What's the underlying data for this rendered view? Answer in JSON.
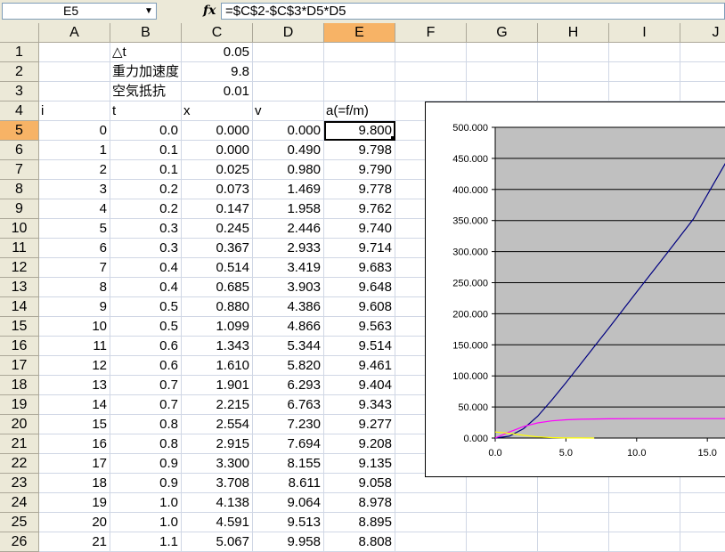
{
  "formula_bar": {
    "name_box": "E5",
    "fx_label": "fx",
    "formula": "=$C$2-$C$3*D5*D5"
  },
  "columns": [
    "A",
    "B",
    "C",
    "D",
    "E",
    "F",
    "G",
    "H",
    "I",
    "J"
  ],
  "selected_column": "E",
  "selected_row": 5,
  "rows": [
    {
      "n": "1",
      "a": "",
      "b": "△t",
      "c": "0.05",
      "d": "",
      "e": ""
    },
    {
      "n": "2",
      "a": "",
      "b": "重力加速度",
      "c": "9.8",
      "d": "",
      "e": ""
    },
    {
      "n": "3",
      "a": "",
      "b": "空気抵抗",
      "c": "0.01",
      "d": "",
      "e": ""
    },
    {
      "n": "4",
      "a": "i",
      "b": "t",
      "c": "x",
      "d": "v",
      "e": "a(=f/m)"
    },
    {
      "n": "5",
      "a": "0",
      "b": "0.0",
      "c": "0.000",
      "d": "0.000",
      "e": "9.800"
    },
    {
      "n": "6",
      "a": "1",
      "b": "0.1",
      "c": "0.000",
      "d": "0.490",
      "e": "9.798"
    },
    {
      "n": "7",
      "a": "2",
      "b": "0.1",
      "c": "0.025",
      "d": "0.980",
      "e": "9.790"
    },
    {
      "n": "8",
      "a": "3",
      "b": "0.2",
      "c": "0.073",
      "d": "1.469",
      "e": "9.778"
    },
    {
      "n": "9",
      "a": "4",
      "b": "0.2",
      "c": "0.147",
      "d": "1.958",
      "e": "9.762"
    },
    {
      "n": "10",
      "a": "5",
      "b": "0.3",
      "c": "0.245",
      "d": "2.446",
      "e": "9.740"
    },
    {
      "n": "11",
      "a": "6",
      "b": "0.3",
      "c": "0.367",
      "d": "2.933",
      "e": "9.714"
    },
    {
      "n": "12",
      "a": "7",
      "b": "0.4",
      "c": "0.514",
      "d": "3.419",
      "e": "9.683"
    },
    {
      "n": "13",
      "a": "8",
      "b": "0.4",
      "c": "0.685",
      "d": "3.903",
      "e": "9.648"
    },
    {
      "n": "14",
      "a": "9",
      "b": "0.5",
      "c": "0.880",
      "d": "4.386",
      "e": "9.608"
    },
    {
      "n": "15",
      "a": "10",
      "b": "0.5",
      "c": "1.099",
      "d": "4.866",
      "e": "9.563"
    },
    {
      "n": "16",
      "a": "11",
      "b": "0.6",
      "c": "1.343",
      "d": "5.344",
      "e": "9.514"
    },
    {
      "n": "17",
      "a": "12",
      "b": "0.6",
      "c": "1.610",
      "d": "5.820",
      "e": "9.461"
    },
    {
      "n": "18",
      "a": "13",
      "b": "0.7",
      "c": "1.901",
      "d": "6.293",
      "e": "9.404"
    },
    {
      "n": "19",
      "a": "14",
      "b": "0.7",
      "c": "2.215",
      "d": "6.763",
      "e": "9.343"
    },
    {
      "n": "20",
      "a": "15",
      "b": "0.8",
      "c": "2.554",
      "d": "7.230",
      "e": "9.277"
    },
    {
      "n": "21",
      "a": "16",
      "b": "0.8",
      "c": "2.915",
      "d": "7.694",
      "e": "9.208"
    },
    {
      "n": "22",
      "a": "17",
      "b": "0.9",
      "c": "3.300",
      "d": "8.155",
      "e": "9.135"
    },
    {
      "n": "23",
      "a": "18",
      "b": "0.9",
      "c": "3.708",
      "d": "8.611",
      "e": "9.058"
    },
    {
      "n": "24",
      "a": "19",
      "b": "1.0",
      "c": "4.138",
      "d": "9.064",
      "e": "8.978"
    },
    {
      "n": "25",
      "a": "20",
      "b": "1.0",
      "c": "4.591",
      "d": "9.513",
      "e": "8.895"
    },
    {
      "n": "26",
      "a": "21",
      "b": "1.1",
      "c": "5.067",
      "d": "9.958",
      "e": "8.808"
    }
  ],
  "chart_data": {
    "type": "line",
    "title": "",
    "xlabel": "",
    "ylabel": "",
    "xlim": [
      0,
      16.5
    ],
    "ylim": [
      0,
      500
    ],
    "x_ticks": [
      "0.0",
      "5.0",
      "10.0",
      "15.0"
    ],
    "y_ticks": [
      "0.000",
      "50.000",
      "100.000",
      "150.000",
      "200.000",
      "250.000",
      "300.000",
      "350.000",
      "400.000",
      "450.000",
      "500.000"
    ],
    "plot_background": "#c0c0c0",
    "grid": "horizontal",
    "series": [
      {
        "color": "#000080",
        "x": [
          0,
          1,
          2,
          3,
          4,
          5,
          6,
          8,
          10,
          12,
          14,
          16.3
        ],
        "values": [
          0,
          3,
          15,
          35,
          61,
          89,
          118,
          176,
          235,
          293,
          352,
          443
        ]
      },
      {
        "color": "#ff00ff",
        "x": [
          0,
          1,
          2,
          3,
          4,
          5,
          6,
          8,
          10,
          12,
          14,
          16.3
        ],
        "values": [
          0,
          9.8,
          18.5,
          24.3,
          27.6,
          29.3,
          30.3,
          31.0,
          31.2,
          31.3,
          31.3,
          31.3
        ]
      },
      {
        "color": "#ffff00",
        "x": [
          0,
          1,
          2,
          3,
          4,
          5,
          6,
          7
        ],
        "values": [
          9.8,
          7.6,
          4.5,
          1.9,
          0.7,
          0.2,
          0.1,
          0
        ]
      }
    ]
  }
}
